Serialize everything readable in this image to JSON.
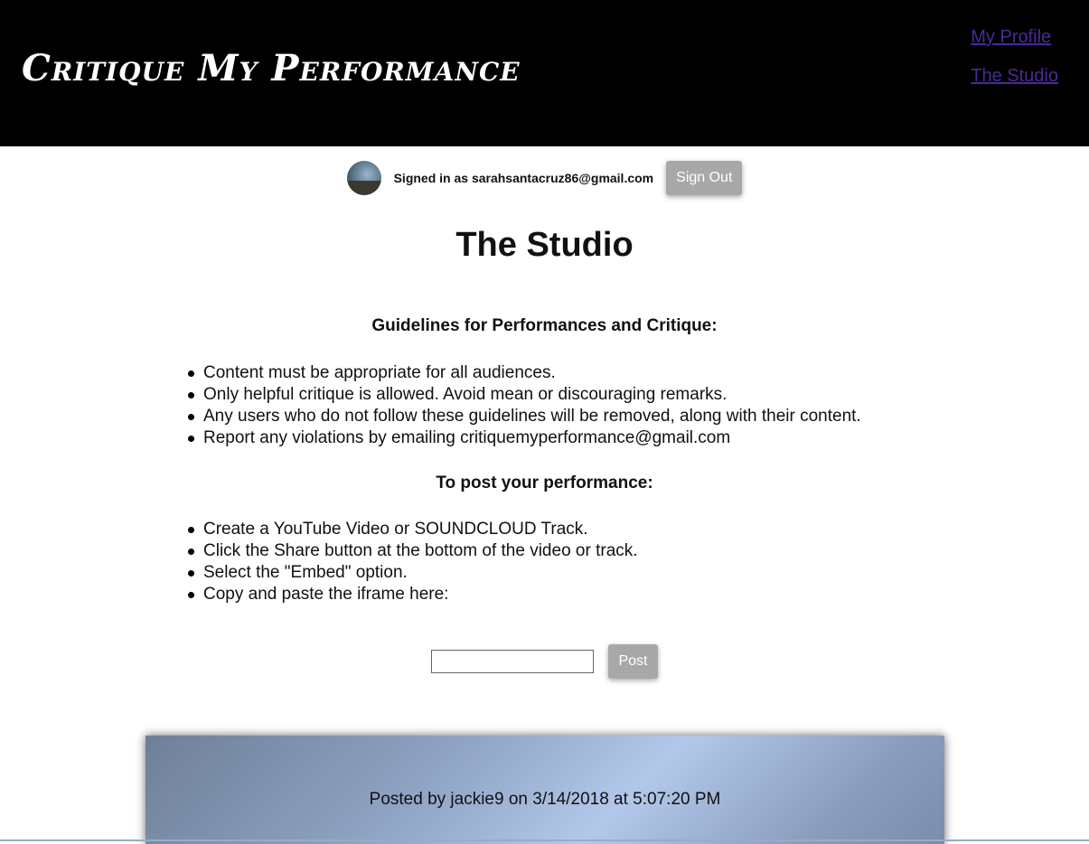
{
  "header": {
    "brand": "Critique My Performance",
    "nav": [
      {
        "label": "My Profile"
      },
      {
        "label": "The Studio"
      }
    ]
  },
  "account": {
    "signed_in_text": "Signed in as sarahsantacruz86@gmail.com",
    "sign_out_label": "Sign Out"
  },
  "page": {
    "title": "The Studio"
  },
  "guidelines": {
    "heading": "Guidelines for Performances and Critique:",
    "items": [
      "Content must be appropriate for all audiences.",
      "Only helpful critique is allowed. Avoid mean or discouraging remarks.",
      "Any users who do not follow these guidelines will be removed, along with their content.",
      "Report any violations by emailing critiquemyperformance@gmail.com"
    ]
  },
  "posting": {
    "heading": "To post your performance:",
    "items": [
      "Create a YouTube Video or SOUNDCLOUD Track.",
      "Click the Share button at the bottom of the video or track.",
      "Select the \"Embed\" option.",
      "Copy and paste the iframe here:"
    ],
    "input_value": "",
    "post_label": "Post"
  },
  "feed": {
    "posts": [
      {
        "byline": "Posted by jackie9 on 3/14/2018 at 5:07:20 PM"
      }
    ]
  },
  "colors": {
    "header_bg": "#000000",
    "nav_link": "#4a2a9a",
    "button_bg": "#a8a8a8"
  }
}
